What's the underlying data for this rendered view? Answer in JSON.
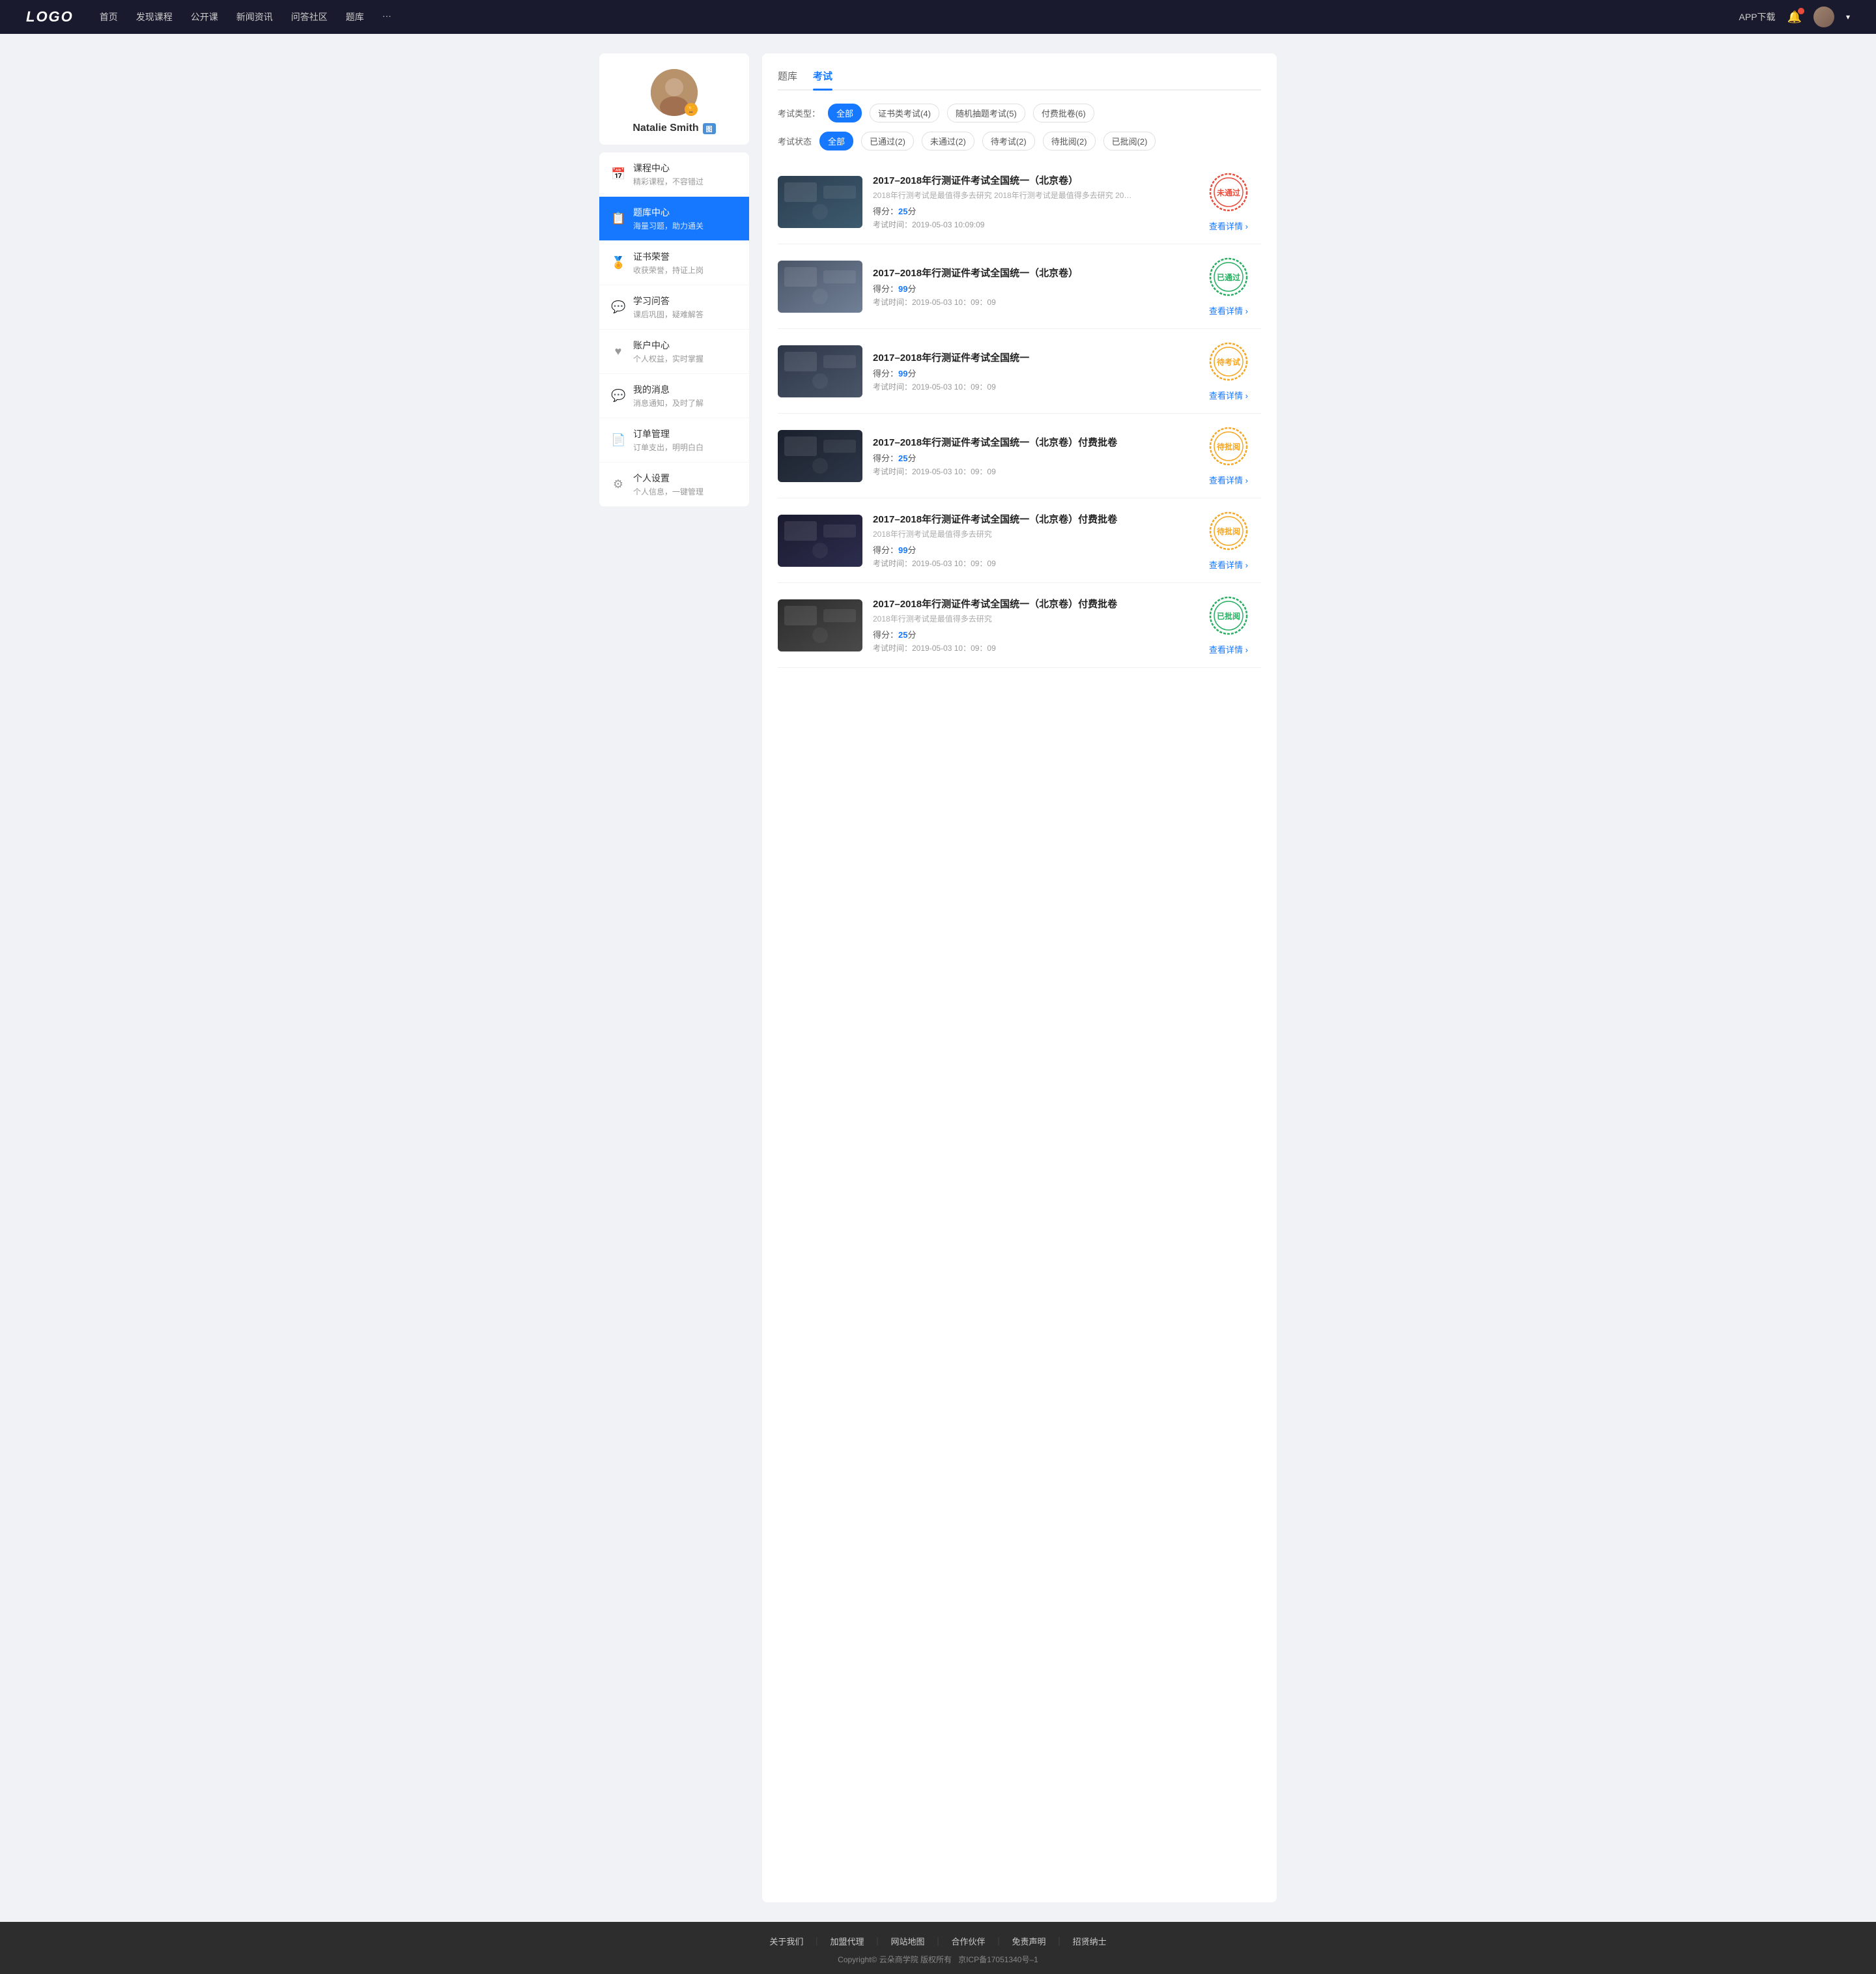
{
  "navbar": {
    "logo": "LOGO",
    "links": [
      {
        "label": "首页",
        "id": "home"
      },
      {
        "label": "发现课程",
        "id": "discover"
      },
      {
        "label": "公开课",
        "id": "open"
      },
      {
        "label": "新闻资讯",
        "id": "news"
      },
      {
        "label": "问答社区",
        "id": "qa"
      },
      {
        "label": "题库",
        "id": "questionbank"
      },
      {
        "label": "···",
        "id": "more"
      }
    ],
    "app_download": "APP下载",
    "avatar_alt": "用户头像"
  },
  "sidebar": {
    "profile": {
      "name": "Natalie Smith",
      "tag": "图"
    },
    "menu": [
      {
        "id": "courses",
        "icon": "📅",
        "title": "课程中心",
        "desc": "精彩课程，不容错过",
        "active": false
      },
      {
        "id": "questionbank",
        "icon": "📋",
        "title": "题库中心",
        "desc": "海量习题，助力通关",
        "active": true
      },
      {
        "id": "certificates",
        "icon": "🏅",
        "title": "证书荣誉",
        "desc": "收获荣誉，持证上岗",
        "active": false
      },
      {
        "id": "qa",
        "icon": "💬",
        "title": "学习问答",
        "desc": "课后巩固，疑难解答",
        "active": false
      },
      {
        "id": "account",
        "icon": "♥",
        "title": "账户中心",
        "desc": "个人权益，实时掌握",
        "active": false
      },
      {
        "id": "messages",
        "icon": "💬",
        "title": "我的消息",
        "desc": "消息通知，及时了解",
        "active": false
      },
      {
        "id": "orders",
        "icon": "📄",
        "title": "订单管理",
        "desc": "订单支出，明明白白",
        "active": false
      },
      {
        "id": "settings",
        "icon": "⚙",
        "title": "个人设置",
        "desc": "个人信息，一键管理",
        "active": false
      }
    ]
  },
  "content": {
    "tabs": [
      {
        "label": "题库",
        "id": "bank",
        "active": false
      },
      {
        "label": "考试",
        "id": "exam",
        "active": true
      }
    ],
    "exam_type_label": "考试类型：",
    "exam_type_filters": [
      {
        "label": "全部",
        "active": true
      },
      {
        "label": "证书类考试(4)",
        "active": false
      },
      {
        "label": "随机抽题考试(5)",
        "active": false
      },
      {
        "label": "付费批卷(6)",
        "active": false
      }
    ],
    "exam_status_label": "考试状态",
    "exam_status_filters": [
      {
        "label": "全部",
        "active": true
      },
      {
        "label": "已通过(2)",
        "active": false
      },
      {
        "label": "未通过(2)",
        "active": false
      },
      {
        "label": "待考试(2)",
        "active": false
      },
      {
        "label": "待批阅(2)",
        "active": false
      },
      {
        "label": "已批阅(2)",
        "active": false
      }
    ],
    "exams": [
      {
        "id": 1,
        "title": "2017–2018年行测证件考试全国统一（北京卷）",
        "desc": "2018年行测考试是最值得多去研究 2018年行测考试是最值得多去研究 2018年行…",
        "score_label": "得分：",
        "score": "25",
        "score_unit": "分",
        "time_label": "考试时间：",
        "time": "2019-05-03  10:09:09",
        "status": "未通过",
        "status_color": "#e74c3c",
        "status_border": "#e74c3c",
        "thumb_class": "thumb-1",
        "detail_link": "查看详情"
      },
      {
        "id": 2,
        "title": "2017–2018年行测证件考试全国统一（北京卷）",
        "desc": "",
        "score_label": "得分：",
        "score": "99",
        "score_unit": "分",
        "time_label": "考试时间：",
        "time": "2019-05-03  10：09：09",
        "status": "已通过",
        "status_color": "#27ae60",
        "status_border": "#27ae60",
        "thumb_class": "thumb-2",
        "detail_link": "查看详情"
      },
      {
        "id": 3,
        "title": "2017–2018年行测证件考试全国统一",
        "desc": "",
        "score_label": "得分：",
        "score": "99",
        "score_unit": "分",
        "time_label": "考试时间：",
        "time": "2019-05-03  10：09：09",
        "status": "待考试",
        "status_color": "#f5a623",
        "status_border": "#f5a623",
        "thumb_class": "thumb-3",
        "detail_link": "查看详情"
      },
      {
        "id": 4,
        "title": "2017–2018年行测证件考试全国统一（北京卷）付费批卷",
        "desc": "",
        "score_label": "得分：",
        "score": "25",
        "score_unit": "分",
        "time_label": "考试时间：",
        "time": "2019-05-03  10：09：09",
        "status": "待批阅",
        "status_color": "#f5a623",
        "status_border": "#f5a623",
        "thumb_class": "thumb-4",
        "detail_link": "查看详情"
      },
      {
        "id": 5,
        "title": "2017–2018年行测证件考试全国统一（北京卷）付费批卷",
        "desc": "2018年行测考试是最值得多去研究",
        "score_label": "得分：",
        "score": "99",
        "score_unit": "分",
        "time_label": "考试时间：",
        "time": "2019-05-03  10：09：09",
        "status": "待批阅",
        "status_color": "#f5a623",
        "status_border": "#f5a623",
        "thumb_class": "thumb-5",
        "detail_link": "查看详情"
      },
      {
        "id": 6,
        "title": "2017–2018年行测证件考试全国统一（北京卷）付费批卷",
        "desc": "2018年行测考试是最值得多去研究",
        "score_label": "得分：",
        "score": "25",
        "score_unit": "分",
        "time_label": "考试时间：",
        "time": "2019-05-03  10：09：09",
        "status": "已批阅",
        "status_color": "#27ae60",
        "status_border": "#27ae60",
        "thumb_class": "thumb-6",
        "detail_link": "查看详情"
      }
    ]
  },
  "footer": {
    "links": [
      {
        "label": "关于我们"
      },
      {
        "label": "加盟代理"
      },
      {
        "label": "网站地图"
      },
      {
        "label": "合作伙伴"
      },
      {
        "label": "免责声明"
      },
      {
        "label": "招贤纳士"
      }
    ],
    "copyright": "Copyright© 云朵商学院  版权所有",
    "icp": "京ICP备17051340号–1"
  }
}
